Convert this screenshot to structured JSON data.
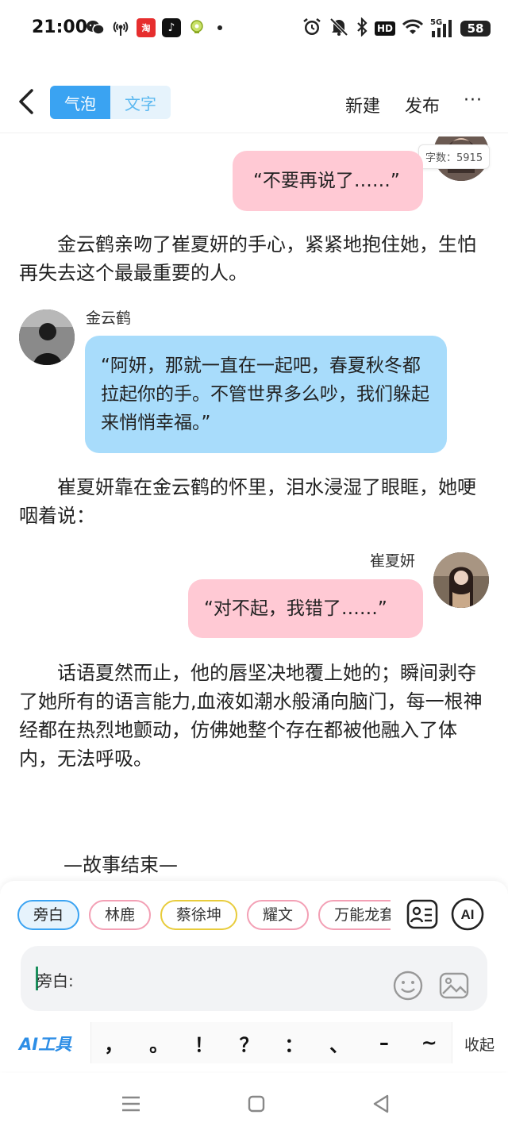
{
  "status": {
    "time": "21:00",
    "left_icons": [
      "wechat-icon",
      "broadcast-icon",
      "taobao-icon",
      "tiktok-icon",
      "location-app-icon",
      "more-notifications-dot"
    ],
    "right_icons": [
      "alarm-icon",
      "mute-icon",
      "bluetooth-icon",
      "hd-icon",
      "wifi-icon",
      "signal-5g-icon",
      "battery-icon"
    ],
    "hd_label": "HD",
    "signal_label": "5G",
    "battery": "58"
  },
  "header": {
    "tab_bubble": "气泡",
    "tab_text": "文字",
    "new_label": "新建",
    "publish_label": "发布",
    "more_label": "···"
  },
  "word_count": "字数：5915",
  "messages": [
    {
      "speaker": "",
      "side": "right",
      "text": "“不要再说了……”"
    },
    {
      "type": "narration",
      "text": "金云鹤亲吻了崔夏妍的手心，紧紧地抱住她，生怕再失去这个最最重要的人。"
    },
    {
      "speaker": "金云鹤",
      "side": "left",
      "text": "“阿妍，那就一直在一起吧，春夏秋冬都拉起你的手。不管世界多么吵，我们躲起来悄悄幸福。”"
    },
    {
      "type": "narration",
      "text": "崔夏妍靠在金云鹤的怀里，泪水浸湿了眼眶，她哽咽着说："
    },
    {
      "speaker": "崔夏妍",
      "side": "right",
      "text": "“对不起，我错了……”"
    },
    {
      "type": "narration",
      "text": "话语夏然而止，他的唇坚决地覆上她的；瞬间剥夺了她所有的语言能力,血液如潮水般涌向脑门，每一根神经都在热烈地颤动，仿佛她整个存在都被他融入了体内，无法呼吸。"
    }
  ],
  "story_end": "—故事结束—",
  "characters": [
    "旁白",
    "林鹿",
    "蔡徐坤",
    "耀文",
    "万能龙套"
  ],
  "input": {
    "label": "旁白:"
  },
  "ai_tools_label": "AI工具",
  "punctuation": [
    "，",
    "。",
    "！",
    "？",
    "：",
    "、",
    "–",
    "~"
  ],
  "collapse_label": "收起",
  "colors": {
    "accent": "#3aa3f2",
    "pink_bubble": "#ffc9d4",
    "blue_bubble": "#a8dcfb"
  }
}
